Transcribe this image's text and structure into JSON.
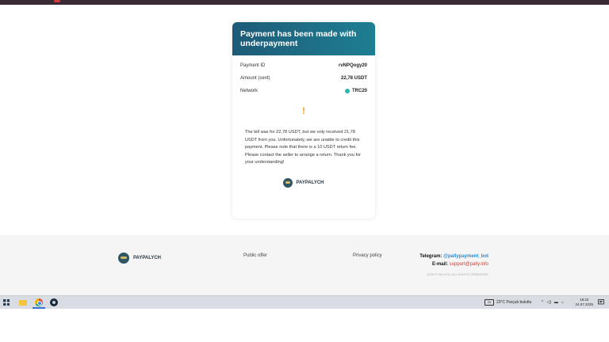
{
  "card": {
    "title": "Payment has been made with underpayment",
    "rows": [
      {
        "label": "Payment ID",
        "value": "rvNPQogy20"
      },
      {
        "label": "Amount (sent)",
        "value": "22,78 USDT"
      },
      {
        "label": "Network",
        "value": "TRC20"
      }
    ],
    "warning_symbol": "!",
    "message": "The bill was for 22,78 USDT, but we only received 21,78 USDT from you. Unfortunately, we are unable to credit this payment. Please note that there is a 10 USDT return fee. Please contact the seller to arrange a return. Thank you for your understanding!",
    "brand": "PAYPALYCH"
  },
  "footer": {
    "brand": "PAYPALYCH",
    "public_offer": "Public offer",
    "privacy_policy": "Privacy policy",
    "telegram_label": "Telegram:",
    "telegram_value": "@pallypayment_bot",
    "email_label": "E-mail:",
    "email_value": "support@pally.info",
    "copyright": "2025 © PALYCH. ALL RIGHTS RESERVED"
  },
  "taskbar": {
    "weather": "23°C  Parçalı bulutlu",
    "time": "18:22",
    "date": "24.07.2025"
  },
  "colors": {
    "header_gradient_start": "#1d5a78",
    "header_gradient_end": "#1e7f92",
    "warning": "#f2a51a",
    "telegram_link": "#2a8bd8",
    "email_link": "#d83b2f"
  }
}
